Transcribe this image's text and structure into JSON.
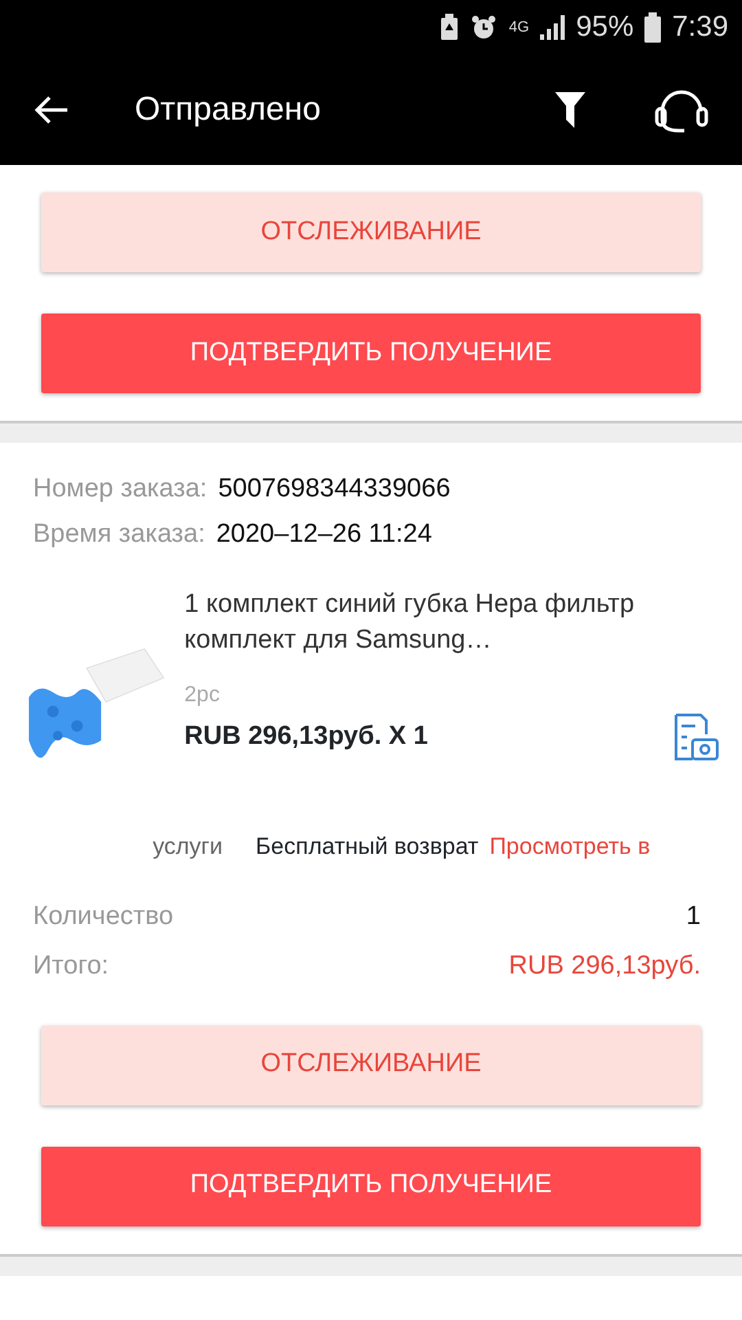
{
  "status_bar": {
    "network": "4G",
    "battery": "95%",
    "time": "7:39"
  },
  "app_bar": {
    "title": "Отправлено"
  },
  "orders": [
    {
      "buttons": [
        {
          "label": "ОТСЛЕЖИВАНИЕ",
          "kind": "secondary"
        },
        {
          "label": "ПОДТВЕРДИТЬ ПОЛУЧЕНИЕ",
          "kind": "primary"
        }
      ]
    },
    {
      "number_label": "Номер заказа:",
      "number": "5007698344339066",
      "time_label": "Время заказа:",
      "time": "2020–12–26 11:24",
      "product": {
        "kind": "picture",
        "title": "1 комплект синий губка Hepa фильтр комплект для Samsung…",
        "variant": "2pc",
        "price": "RUB 296,13руб. X 1"
      },
      "services_label": "услуги",
      "service": "Бесплатный возврат",
      "service_link": "Просмотреть в",
      "quantity_label": "Количество",
      "quantity": "1",
      "total_label": "Итого:",
      "total": "RUB 296,13руб.",
      "buttons": [
        {
          "label": "ОТСЛЕЖИВАНИЕ",
          "kind": "secondary"
        },
        {
          "label": "ПОДТВЕРДИТЬ ПОЛУЧЕНИЕ",
          "kind": "primary"
        }
      ]
    }
  ]
}
